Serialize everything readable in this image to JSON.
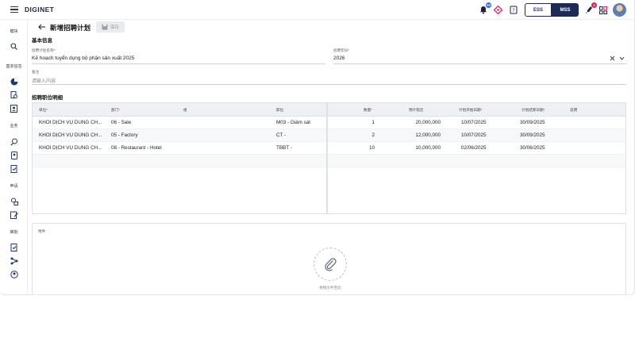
{
  "topbar": {
    "logo": "DIGINET",
    "bell_badge": "99",
    "notify_badge": "4",
    "ess_label": "ESS",
    "mss_label": "MSS",
    "colors": {
      "brand": "#1e2a56",
      "badge_blue": "#2f6fd6",
      "badge_red": "#e0245e",
      "accent_red": "#e0245e"
    }
  },
  "sidebar": {
    "groups": [
      {
        "label": "模块"
      },
      {
        "label": "基本信息"
      },
      {
        "label": "业务"
      },
      {
        "label": "申请"
      },
      {
        "label": "审批"
      }
    ]
  },
  "page": {
    "title": "新增招聘计划",
    "save_label": "保存"
  },
  "basic_info": {
    "section_title": "基本信息",
    "plan_name_label": "招聘计划名称",
    "plan_name_value": "Kế hoạch tuyển dụng bộ phận sản xuất 2025",
    "year_label": "招聘年份",
    "year_value": "2026",
    "note_label": "备注",
    "note_placeholder": "请输入内容"
  },
  "grid": {
    "section_title": "招聘职位明细",
    "headers": {
      "unit": "单位",
      "dept": "部门",
      "group": "组",
      "position": "职位",
      "quantity": "数量",
      "budget": "预计箭灵",
      "start": "计划开始日期",
      "end": "计划结束日期",
      "desc": "说明"
    },
    "rows": [
      {
        "unit": "KHỐI DỊCH VỤ DÙNG CH...",
        "dept": "06 - Sale",
        "group": "",
        "position": "M03 - Giám sát",
        "quantity": "1",
        "budget": "20,000,000",
        "start": "10/07/2025",
        "end": "30/09/2025",
        "desc": ""
      },
      {
        "unit": "KHỐI DỊCH VỤ DÙNG CH...",
        "dept": "05 - Factory",
        "group": "",
        "position": "CT -",
        "quantity": "2",
        "budget": "12,000,000",
        "start": "10/07/2025",
        "end": "30/09/2025",
        "desc": ""
      },
      {
        "unit": "KHỐI DỊCH VỤ DÙNG CH...",
        "dept": "08 - Restaurant - Hotel",
        "group": "",
        "position": "TBBT -",
        "quantity": "10",
        "budget": "10,000,000",
        "start": "02/06/2025",
        "end": "30/06/2025",
        "desc": ""
      }
    ]
  },
  "attachment": {
    "label": "附件",
    "drop_text": "拖拽文件至此"
  }
}
